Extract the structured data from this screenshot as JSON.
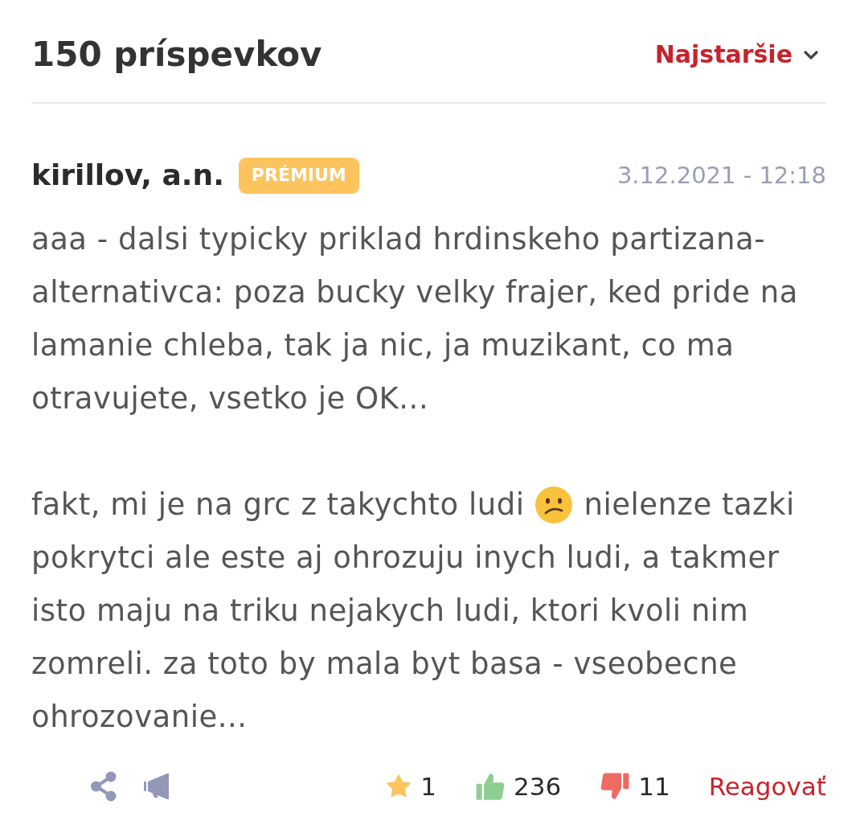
{
  "header": {
    "title": "150 príspevkov",
    "sort": {
      "label": "Najstaršie"
    }
  },
  "comment": {
    "author": "kirillov, a.n.",
    "badge": "PRÉMIUM",
    "date": "3.12.2021 - 12:18",
    "paragraphs": [
      {
        "lines": [
          [
            {
              "kind": "text",
              "text": "aaa - dalsi typicky priklad hrdinskeho partizana-"
            }
          ],
          [
            {
              "kind": "text",
              "text": "alternativca: poza bucky velky frajer, ked pride na"
            }
          ],
          [
            {
              "kind": "text",
              "text": "lamanie chleba, tak ja nic, ja muzikant, co ma"
            }
          ],
          [
            {
              "kind": "text",
              "text": "otravujete, vsetko je OK..."
            }
          ]
        ]
      },
      {
        "lines": [
          [
            {
              "kind": "text",
              "text": "fakt, mi je na grc z takychto ludi"
            },
            {
              "kind": "emoji"
            },
            {
              "kind": "text",
              "text": "nielenze tazki"
            }
          ],
          [
            {
              "kind": "text",
              "text": "pokrytci ale este aj ohrozuju inych ludi, a takmer"
            }
          ],
          [
            {
              "kind": "text",
              "text": "isto maju na triku nejakych ludi, ktori kvoli nim"
            }
          ],
          [
            {
              "kind": "text",
              "text": "zomreli. za toto by mala byt basa - vseobecne"
            }
          ],
          [
            {
              "kind": "text",
              "text": "ohrozovanie..."
            }
          ]
        ]
      }
    ],
    "reactions": [
      {
        "kind": "star",
        "count": "1"
      },
      {
        "kind": "like",
        "count": "236"
      },
      {
        "kind": "dislike",
        "count": "11"
      }
    ],
    "reply": "Reagovať"
  }
}
